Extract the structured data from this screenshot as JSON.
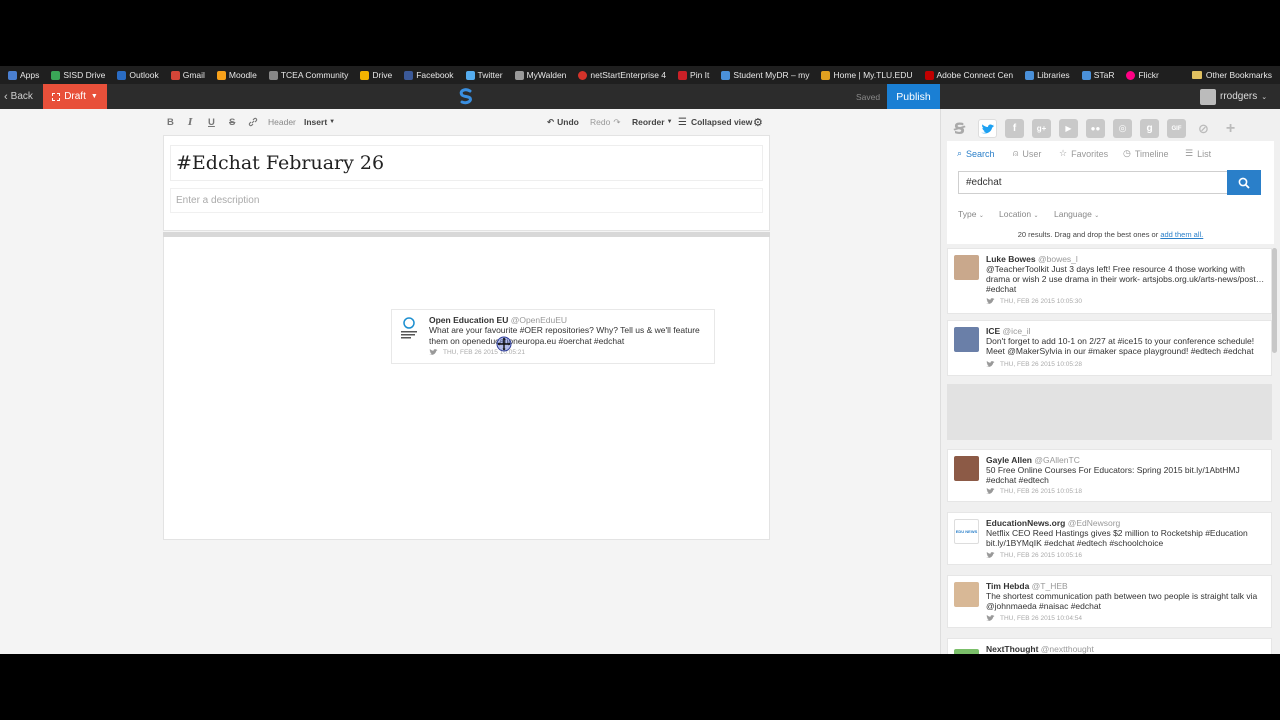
{
  "bookmarks": [
    {
      "label": "Apps",
      "color": "#4a7fd1"
    },
    {
      "label": "SISD Drive",
      "color": "#3aa757"
    },
    {
      "label": "Outlook",
      "color": "#2a6cc4"
    },
    {
      "label": "Gmail",
      "color": "#d44638"
    },
    {
      "label": "Moodle",
      "color": "#f7a11a"
    },
    {
      "label": "TCEA Community",
      "color": "#888888"
    },
    {
      "label": "Drive",
      "color": "#f4b400"
    },
    {
      "label": "Facebook",
      "color": "#3b5998"
    },
    {
      "label": "Twitter",
      "color": "#55acee"
    },
    {
      "label": "MyWalden",
      "color": "#9a9a9a"
    },
    {
      "label": "netStartEnterprise 4",
      "color": "#d4332a"
    },
    {
      "label": "Pin It",
      "color": "#cb2027"
    },
    {
      "label": "Student MyDR – my",
      "color": "#4a90d9"
    },
    {
      "label": "Home | My.TLU.EDU",
      "color": "#e0a020"
    },
    {
      "label": "Adobe Connect Cen",
      "color": "#c00000"
    },
    {
      "label": "Libraries",
      "color": "#4a90d9"
    },
    {
      "label": "STaR",
      "color": "#4a90d9"
    },
    {
      "label": "Flickr",
      "color": "#ff0084"
    }
  ],
  "other_bookmarks": "Other Bookmarks",
  "header": {
    "back": "Back",
    "draft": "Draft",
    "saved": "Saved",
    "publish": "Publish",
    "username": "rrodgers"
  },
  "toolbar": {
    "bold": "B",
    "italic": "I",
    "underline": "U",
    "strike": "S",
    "header": "Header",
    "insert": "Insert",
    "undo": "Undo",
    "redo": "Redo",
    "reorder": "Reorder",
    "collapsed_view": "Collapsed view"
  },
  "story": {
    "title": "#Edchat February 26",
    "description_placeholder": "Enter a description"
  },
  "dropped_tweet": {
    "name": "Open Education EU",
    "handle": "@OpenEduEU",
    "text": "What are your favourite #OER repositories? Why? Tell us & we'll feature them on openeducationeuropa.eu #oerchat #edchat",
    "time": "THU, FEB 26 2015 10:05:21"
  },
  "search": {
    "tabs": [
      "Search",
      "User",
      "Favorites",
      "Timeline",
      "List"
    ],
    "query": "#edchat",
    "filters": [
      "Type",
      "Location",
      "Language"
    ],
    "results_text": "20 results. Drag and drop the best ones or",
    "add_all": "add them all."
  },
  "results": [
    {
      "name": "Luke Bowes",
      "handle": "@bowes_l",
      "text": "@TeacherToolkit Just 3 days left! Free resource 4 those working with drama or wish 2 use drama in their work- artsjobs.org.uk/arts-news/post… #edchat",
      "time": "THU, FEB 26 2015 10:05:30"
    },
    {
      "name": "ICE",
      "handle": "@ice_il",
      "text": "Don't forget to add 10-1 on 2/27 at #ice15 to your conference schedule! Meet @MakerSylvia in our #maker space playground! #edtech #edchat",
      "time": "THU, FEB 26 2015 10:05:28"
    },
    {
      "name": "Gayle Allen",
      "handle": "@GAllenTC",
      "text": "50 Free Online Courses For Educators: Spring 2015 bit.ly/1AbtHMJ #edchat #edtech",
      "time": "THU, FEB 26 2015 10:05:18"
    },
    {
      "name": "EducationNews.org",
      "handle": "@EdNewsorg",
      "text": "Netflix CEO Reed Hastings gives $2 million to Rocketship #Education bit.ly/1BYMqIK #edchat #edtech #schoolchoice",
      "time": "THU, FEB 26 2015 10:05:16"
    },
    {
      "name": "Tim Hebda",
      "handle": "@T_HEB",
      "text": "The shortest communication path between two people is straight talk via @johnmaeda #naisac #edchat",
      "time": "THU, FEB 26 2015 10:04:54"
    },
    {
      "name": "NextThought",
      "handle": "@nextthought",
      "text": "",
      "time": ""
    }
  ],
  "colors": {
    "accent": "#2a7fc9",
    "draft": "#e8503a",
    "publish": "#1a7fd4",
    "twitter": "#55acee"
  }
}
